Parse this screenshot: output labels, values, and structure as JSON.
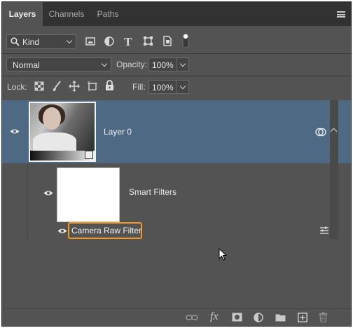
{
  "tabs": [
    {
      "label": "Layers",
      "active": true
    },
    {
      "label": "Channels",
      "active": false
    },
    {
      "label": "Paths",
      "active": false
    }
  ],
  "filter": {
    "kind_label": "Kind",
    "icons": [
      "image-filter-icon",
      "adjustment-filter-icon",
      "type-filter-icon",
      "shape-filter-icon",
      "smart-object-filter-icon",
      "filter-toggle-icon"
    ]
  },
  "blend": {
    "mode": "Normal",
    "opacity_label": "Opacity:",
    "opacity_value": "100%"
  },
  "lock": {
    "label": "Lock:",
    "fill_label": "Fill:",
    "fill_value": "100%"
  },
  "layers": {
    "layer0_name": "Layer 0",
    "smart_filters_label": "Smart Filters",
    "filter_name": "Camera Raw Filter",
    "highlight_color": "#f39820",
    "selected_color": "#4e6983"
  },
  "bottom_icons": [
    "link-layers-icon",
    "fx-icon",
    "add-mask-icon",
    "adjustment-layer-icon",
    "new-group-icon",
    "new-layer-icon",
    "delete-layer-icon"
  ],
  "bottom_fx_label": "fx"
}
